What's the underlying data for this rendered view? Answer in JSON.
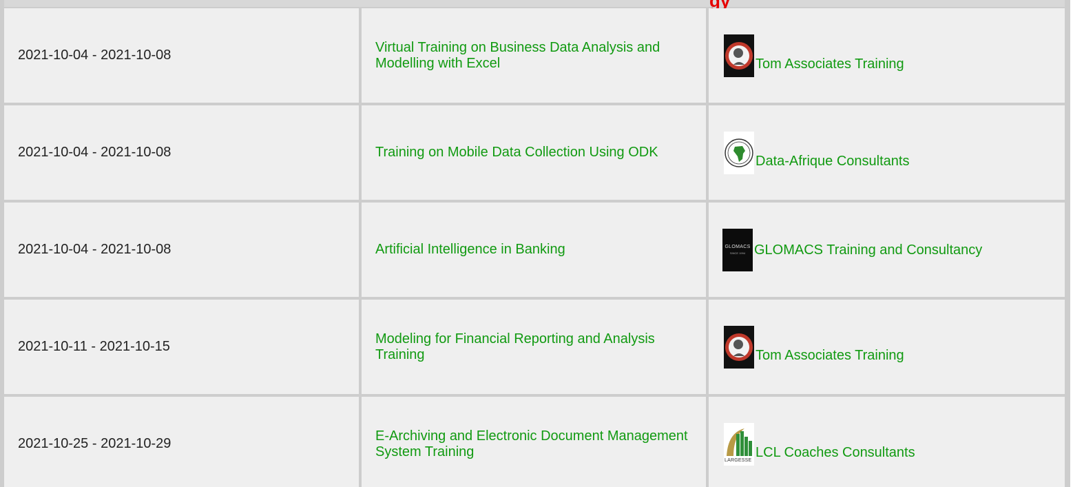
{
  "header": {
    "partial_title": "gy"
  },
  "rows": [
    {
      "dates": "2021-10-04 - 2021-10-08",
      "title": "Virtual Training on Business Data Analysis and Modelling with Excel",
      "organizer": "Tom Associates Training",
      "logo": "tom-associates-logo"
    },
    {
      "dates": "2021-10-04 - 2021-10-08",
      "title": "Training on Mobile Data Collection Using ODK",
      "organizer": "Data-Afrique Consultants",
      "logo": "data-afrique-logo"
    },
    {
      "dates": "2021-10-04 - 2021-10-08",
      "title": "Artificial Intelligence in Banking",
      "organizer": "GLOMACS Training and Consultancy",
      "logo": "glomacs-logo",
      "logo_text": "GLOMACS",
      "logo_subtext": "SINCE 1994"
    },
    {
      "dates": "2021-10-11 - 2021-10-15",
      "title": "Modeling for Financial Reporting and Analysis Training",
      "organizer": "Tom Associates Training",
      "logo": "tom-associates-logo"
    },
    {
      "dates": "2021-10-25 - 2021-10-29",
      "title": "E-Archiving and Electronic Document Management System Training",
      "organizer": "LCL Coaches Consultants",
      "logo": "largesse-logo",
      "logo_text": "LARGESSE"
    }
  ],
  "colors": {
    "link": "#119a11",
    "header_text": "#e60000",
    "cell_bg": "#efefef",
    "divider": "#cdcdcd"
  }
}
